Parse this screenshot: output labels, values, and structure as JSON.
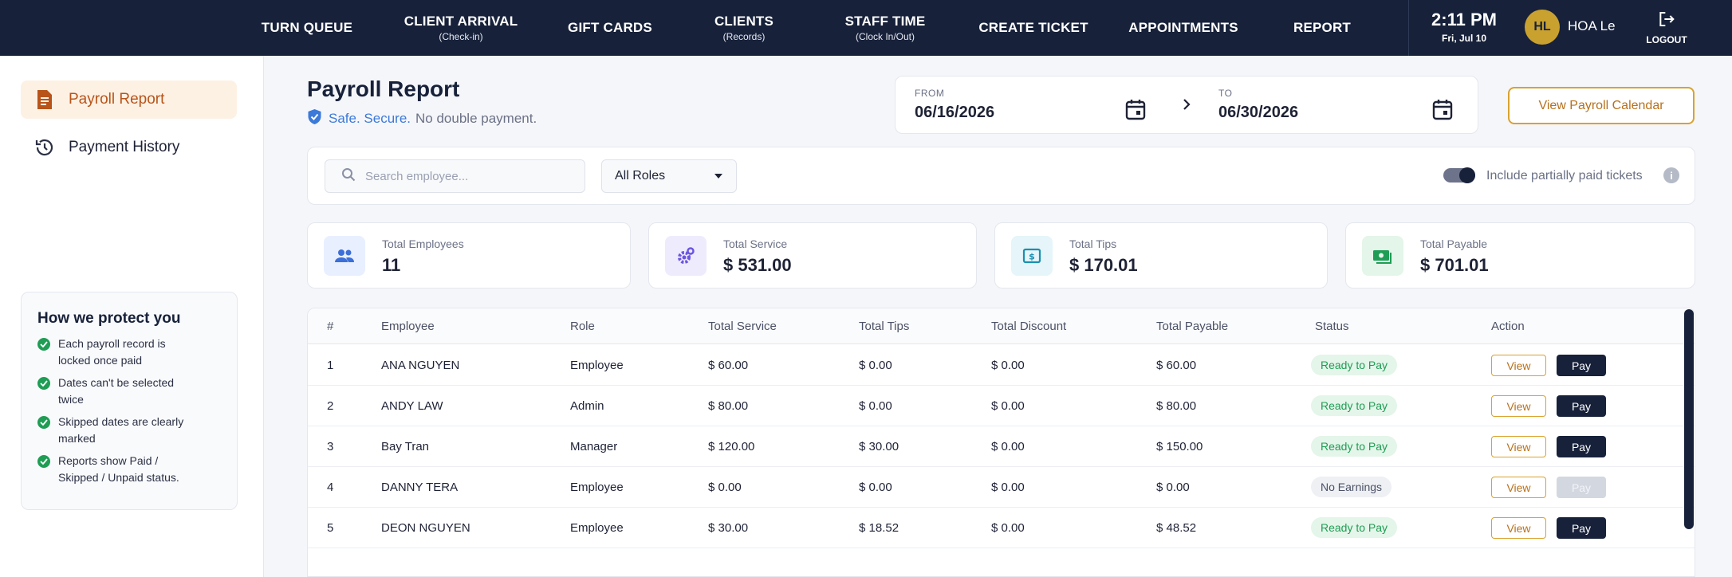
{
  "nav": {
    "items": [
      {
        "label": "TURN QUEUE",
        "sub": ""
      },
      {
        "label": "CLIENT ARRIVAL",
        "sub": "(Check-in)"
      },
      {
        "label": "GIFT CARDS",
        "sub": ""
      },
      {
        "label": "CLIENTS",
        "sub": "(Records)"
      },
      {
        "label": "STAFF TIME",
        "sub": "(Clock In/Out)"
      },
      {
        "label": "CREATE TICKET",
        "sub": ""
      },
      {
        "label": "APPOINTMENTS",
        "sub": ""
      },
      {
        "label": "REPORT",
        "sub": ""
      }
    ],
    "time": "2:11 PM",
    "date": "Fri, Jul 10",
    "avatar_initials": "HL",
    "user_name": "HOA Le",
    "logout_label": "LOGOUT"
  },
  "sidebar": {
    "items": [
      {
        "label": "Payroll Report",
        "active": true
      },
      {
        "label": "Payment History",
        "active": false
      }
    ],
    "protect": {
      "title": "How we protect you",
      "items": [
        "Each payroll record is locked once paid",
        "Dates can't be selected twice",
        "Skipped dates are clearly marked",
        "Reports show Paid / Skipped / Unpaid status."
      ]
    }
  },
  "header": {
    "title": "Payroll Report",
    "secure_highlight": "Safe. Secure.",
    "secure_rest": "No double payment.",
    "from_label": "FROM",
    "from_date": "06/16/2026",
    "to_label": "TO",
    "to_date": "06/30/2026",
    "calendar_button": "View Payroll Calendar"
  },
  "filters": {
    "search_placeholder": "Search employee...",
    "role_selected": "All Roles",
    "toggle_label": "Include partially paid tickets",
    "toggle_on": true
  },
  "stats": [
    {
      "label": "Total Employees",
      "value": "11",
      "icon": "users-icon"
    },
    {
      "label": "Total Service",
      "value": "$ 531.00",
      "icon": "gear-icon"
    },
    {
      "label": "Total Tips",
      "value": "$ 170.01",
      "icon": "dollar-bill-icon"
    },
    {
      "label": "Total Payable",
      "value": "$ 701.01",
      "icon": "cash-icon"
    }
  ],
  "colors": {
    "nav_bg": "#17213a",
    "accent_gold": "#d9a22e",
    "active_text": "#b8541a",
    "ready_green": "#1f9d55"
  },
  "table": {
    "headers": [
      "#",
      "Employee",
      "Role",
      "Total Service",
      "Total Tips",
      "Total Discount",
      "Total Payable",
      "Status",
      "Action"
    ],
    "view_label": "View",
    "pay_label": "Pay",
    "rows": [
      {
        "num": "1",
        "employee": "ANA NGUYEN",
        "role": "Employee",
        "service": "$ 60.00",
        "tips": "$ 0.00",
        "discount": "$ 0.00",
        "payable": "$ 60.00",
        "status": "Ready to Pay",
        "pay_enabled": true
      },
      {
        "num": "2",
        "employee": "ANDY LAW",
        "role": "Admin",
        "service": "$ 80.00",
        "tips": "$ 0.00",
        "discount": "$ 0.00",
        "payable": "$ 80.00",
        "status": "Ready to Pay",
        "pay_enabled": true
      },
      {
        "num": "3",
        "employee": "Bay Tran",
        "role": "Manager",
        "service": "$ 120.00",
        "tips": "$ 30.00",
        "discount": "$ 0.00",
        "payable": "$ 150.00",
        "status": "Ready to Pay",
        "pay_enabled": true
      },
      {
        "num": "4",
        "employee": "DANNY TERA",
        "role": "Employee",
        "service": "$ 0.00",
        "tips": "$ 0.00",
        "discount": "$ 0.00",
        "payable": "$ 0.00",
        "status": "No Earnings",
        "pay_enabled": false
      },
      {
        "num": "5",
        "employee": "DEON NGUYEN",
        "role": "Employee",
        "service": "$ 30.00",
        "tips": "$ 18.52",
        "discount": "$ 0.00",
        "payable": "$ 48.52",
        "status": "Ready to Pay",
        "pay_enabled": true
      }
    ]
  }
}
